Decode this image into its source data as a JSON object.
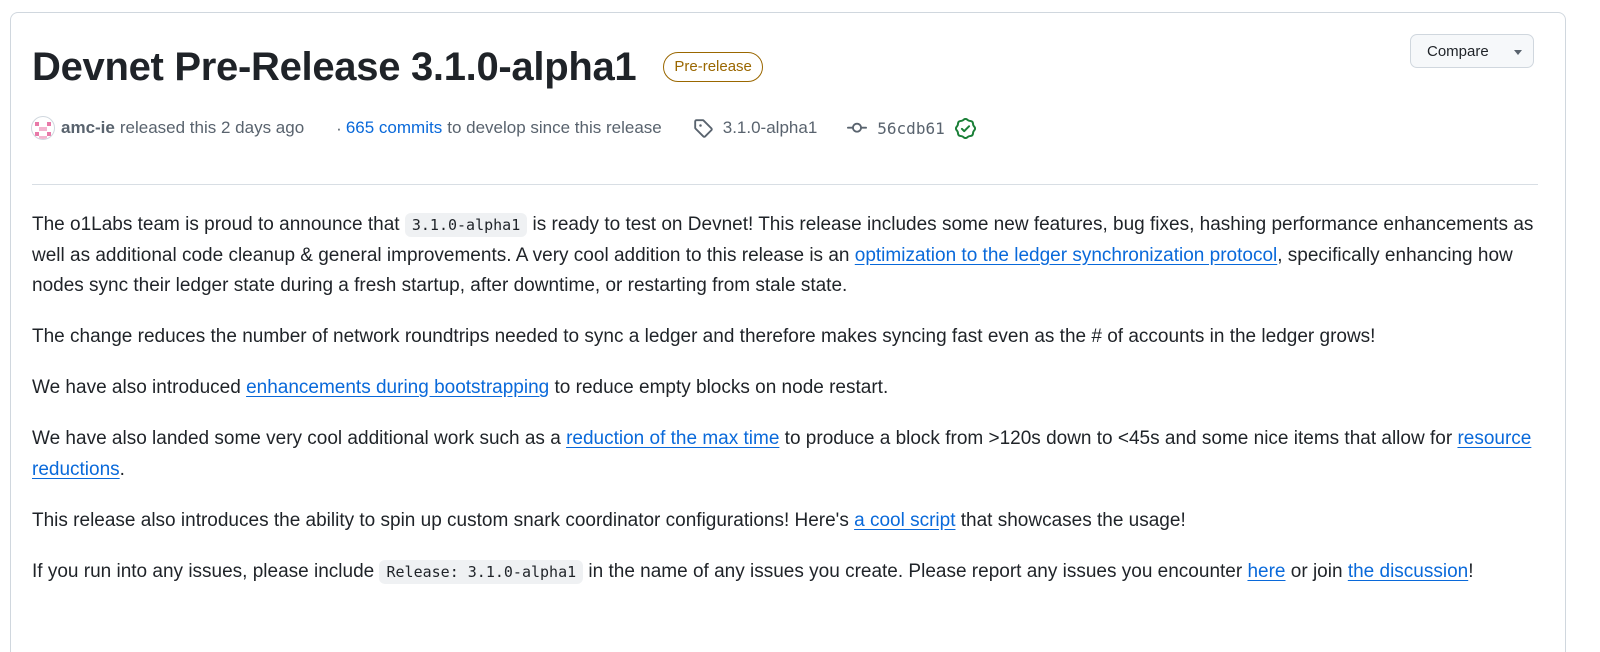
{
  "release": {
    "title": "Devnet Pre-Release 3.1.0-alpha1",
    "badge": "Pre-release",
    "compare_label": "Compare"
  },
  "meta": {
    "author": "amc-ie",
    "released_text": "released this 2 days ago",
    "dot": "·",
    "commits_link": "665 commits",
    "commits_suffix": "to develop since this release",
    "tag": "3.1.0-alpha1",
    "commit_sha": "56cdb61",
    "verified": true
  },
  "colors": {
    "link": "#0969da",
    "prerelease_badge": "#9a6700",
    "verified_check": "#1a7f37",
    "muted_text": "#59636e"
  },
  "body": {
    "p1": {
      "t1": "The o1Labs team is proud to announce that ",
      "code": "3.1.0-alpha1",
      "t2": " is ready to test on Devnet! This release includes some new features, bug fixes, hashing performance enhancements as well as additional code cleanup & general improvements. A very cool addition to this release is an ",
      "link": "optimization to the ledger synchronization protocol",
      "t3": ", specifically enhancing how nodes sync their ledger state during a fresh startup, after downtime, or restarting from stale state."
    },
    "p2": "The change reduces the number of network roundtrips needed to sync a ledger and therefore makes syncing fast even as the # of accounts in the ledger grows!",
    "p3": {
      "t1": "We have also introduced ",
      "link": "enhancements during bootstrapping",
      "t2": " to reduce empty blocks on node restart."
    },
    "p4": {
      "t1": "We have also landed some very cool additional work such as a ",
      "link1": "reduction of the max time",
      "t2": " to produce a block from >120s down to <45s and some nice items that allow for ",
      "link2": "resource reductions",
      "t3": "."
    },
    "p5": {
      "t1": "This release also introduces the ability to spin up custom snark coordinator configurations! Here's ",
      "link": "a cool script",
      "t2": " that showcases the usage!"
    },
    "p6": {
      "t1": "If you run into any issues, please include ",
      "code": "Release: 3.1.0-alpha1",
      "t2": " in the name of any issues you create. Please report any issues you encounter ",
      "link1": "here",
      "t3": " or join ",
      "link2": "the discussion",
      "t4": "!"
    }
  }
}
